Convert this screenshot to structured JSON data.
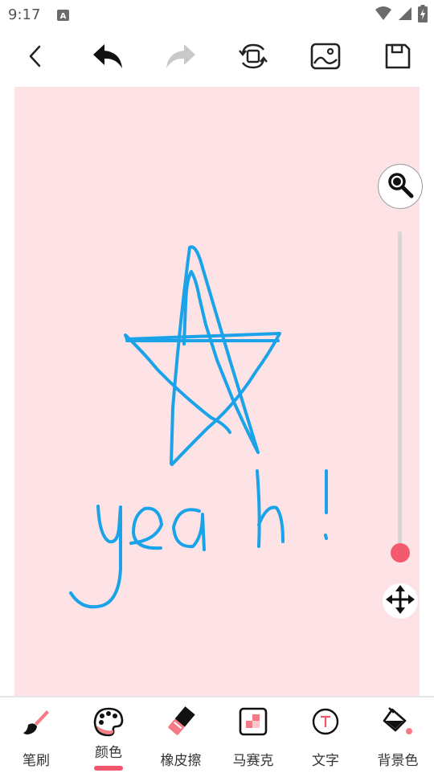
{
  "status_bar": {
    "time": "9:17",
    "notification_icon": "a-icon",
    "icons": [
      "wifi-icon",
      "signal-icon",
      "battery-charging-icon"
    ]
  },
  "toolbar": {
    "icons": [
      "back-icon",
      "undo-icon",
      "redo-icon",
      "rotate-icon",
      "image-icon",
      "save-icon"
    ],
    "redo_enabled": false
  },
  "canvas": {
    "background_color": "#fde3e6",
    "stroke_color": "#1aa3e8",
    "drawn_text": "yeah!"
  },
  "side_controls": {
    "zoom_icon": "magnifier-icon",
    "move_icon": "move-arrows-icon",
    "brush_size_slider": 1.0
  },
  "tools": [
    {
      "label": "笔刷",
      "icon": "brush-icon",
      "active": false
    },
    {
      "label": "颜色",
      "icon": "palette-icon",
      "active": true
    },
    {
      "label": "橡皮擦",
      "icon": "eraser-icon",
      "active": false
    },
    {
      "label": "马赛克",
      "icon": "mosaic-icon",
      "active": false
    },
    {
      "label": "文字",
      "icon": "text-icon",
      "active": false
    },
    {
      "label": "背景色",
      "icon": "paint-bucket-icon",
      "active": false
    }
  ],
  "colors": {
    "accent": "#f0566c",
    "slider_thumb": "#f35a6e"
  }
}
